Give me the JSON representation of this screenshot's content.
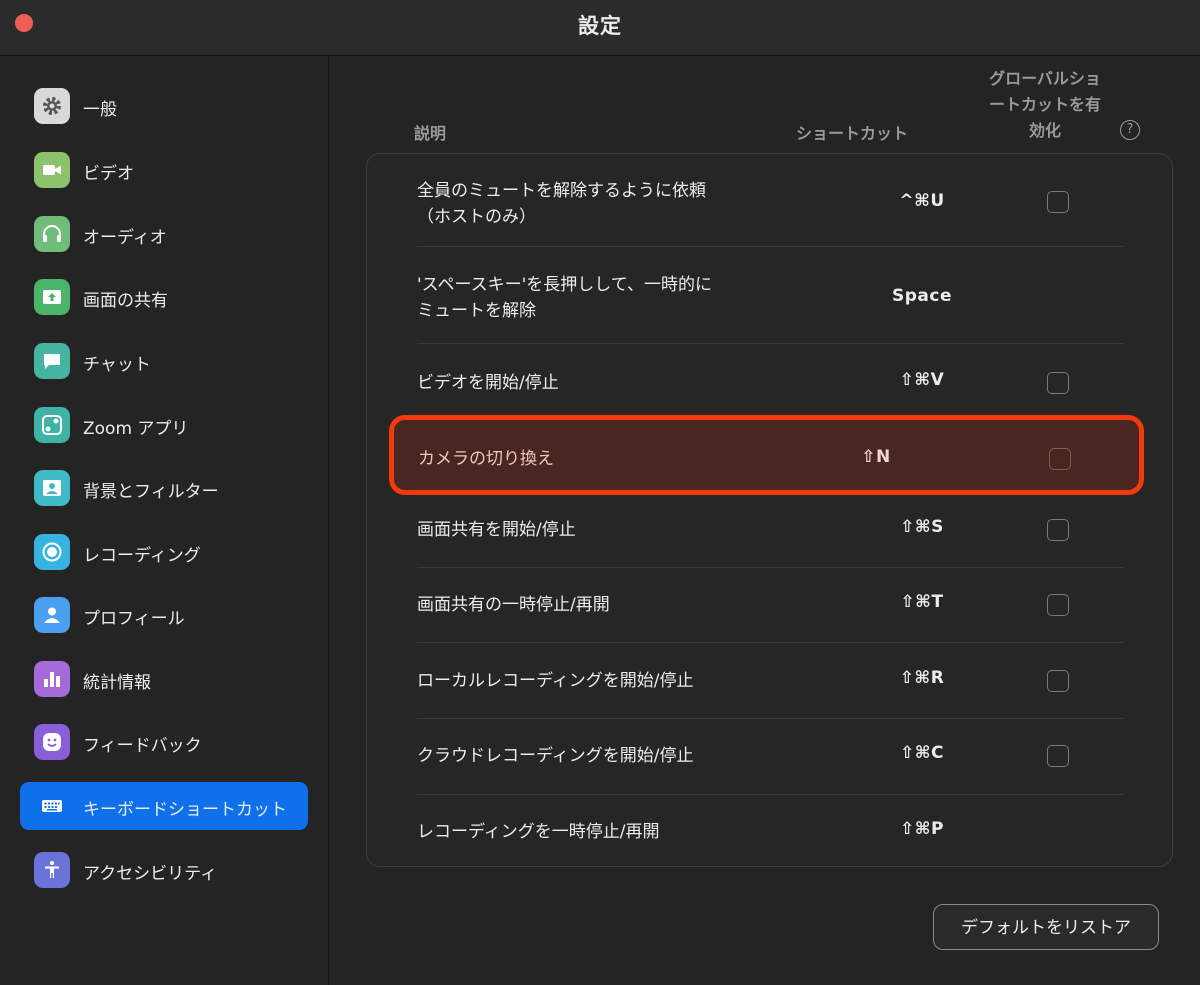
{
  "window": {
    "title": "設定"
  },
  "sidebar": {
    "items": [
      {
        "label": "一般",
        "icon": "gear-icon",
        "color": "#d9d9d9"
      },
      {
        "label": "ビデオ",
        "icon": "video-camera-icon",
        "color": "#8bc26b"
      },
      {
        "label": "オーディオ",
        "icon": "headphones-icon",
        "color": "#6fbd79"
      },
      {
        "label": "画面の共有",
        "icon": "share-screen-icon",
        "color": "#4cb46a"
      },
      {
        "label": "チャット",
        "icon": "chat-bubble-icon",
        "color": "#45b5a1"
      },
      {
        "label": "Zoom アプリ",
        "icon": "apps-icon",
        "color": "#3fb3a6"
      },
      {
        "label": "背景とフィルター",
        "icon": "background-icon",
        "color": "#3fb9c4"
      },
      {
        "label": "レコーディング",
        "icon": "record-icon",
        "color": "#35b4e2"
      },
      {
        "label": "プロフィール",
        "icon": "profile-icon",
        "color": "#4a9ff0"
      },
      {
        "label": "統計情報",
        "icon": "statistics-icon",
        "color": "#a56ad8"
      },
      {
        "label": "フィードバック",
        "icon": "feedback-smile-icon",
        "color": "#8a5ed9"
      },
      {
        "label": "キーボードショートカット",
        "icon": "keyboard-icon",
        "color": "#0e71eb",
        "active": true
      },
      {
        "label": "アクセシビリティ",
        "icon": "accessibility-icon",
        "color": "#6a74d8"
      }
    ]
  },
  "table": {
    "headers": {
      "description": "説明",
      "shortcut": "ショートカット",
      "global": [
        "グローバルショ",
        "ートカットを有",
        "効化"
      ],
      "help": "?"
    },
    "rows": [
      {
        "description": [
          "全員のミュートを解除するように依頼",
          "（ホストのみ）"
        ],
        "shortcut": "^⌘U",
        "has_checkbox": true,
        "checked": false
      },
      {
        "description": [
          "'スペースキー'を長押しして、一時的に",
          "ミュートを解除"
        ],
        "shortcut": "Space",
        "has_checkbox": false,
        "checked": false
      },
      {
        "description": [
          "ビデオを開始/停止"
        ],
        "shortcut": "⇧⌘V",
        "has_checkbox": true,
        "checked": false
      },
      {
        "description": [
          "カメラの切り換え"
        ],
        "shortcut": "⇧N",
        "has_checkbox": true,
        "checked": false,
        "highlighted": true
      },
      {
        "description": [
          "画面共有を開始/停止"
        ],
        "shortcut": "⇧⌘S",
        "has_checkbox": true,
        "checked": false
      },
      {
        "description": [
          "画面共有の一時停止/再開"
        ],
        "shortcut": "⇧⌘T",
        "has_checkbox": true,
        "checked": false
      },
      {
        "description": [
          "ローカルレコーディングを開始/停止"
        ],
        "shortcut": "⇧⌘R",
        "has_checkbox": true,
        "checked": false
      },
      {
        "description": [
          "クラウドレコーディングを開始/停止"
        ],
        "shortcut": "⇧⌘C",
        "has_checkbox": true,
        "checked": false
      },
      {
        "description": [
          "レコーディングを一時停止/再開"
        ],
        "shortcut": "⇧⌘P",
        "has_checkbox": false,
        "checked": false
      }
    ]
  },
  "footer": {
    "restore_label": "デフォルトをリストア"
  },
  "colors": {
    "accent": "#0e71eb",
    "highlight_border": "#f23a0c"
  }
}
